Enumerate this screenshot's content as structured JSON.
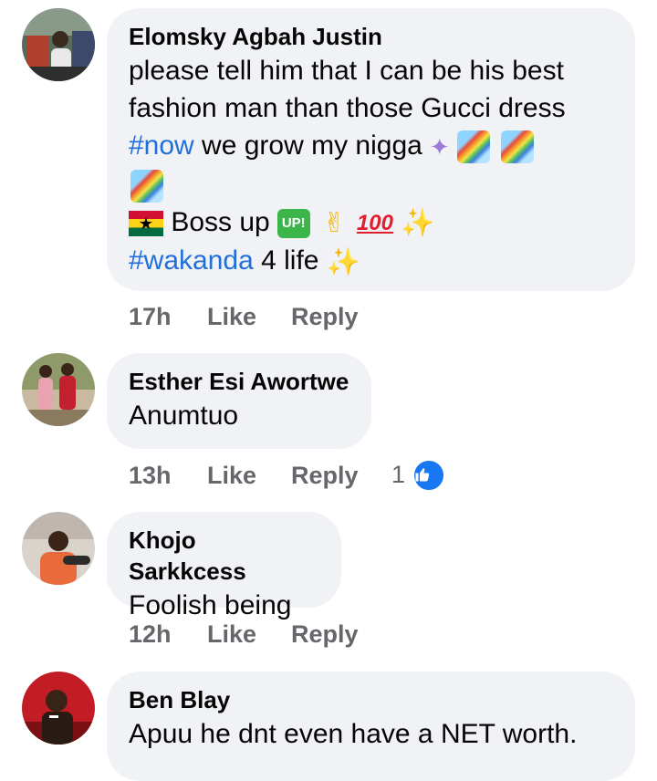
{
  "comments": [
    {
      "author": "Elomsky Agbah Justin",
      "lines": {
        "l1": "please tell him that I can be his best",
        "l2": "fashion man than those Gucci dress",
        "l3_tag": "#now",
        "l3_text": " we grow my nigga",
        "l5_text": "Boss up",
        "l5_up": "UP!",
        "l5_hundred": "100",
        "l6_tag": "#wakanda",
        "l6_text": " 4 life"
      },
      "emojis": [
        "orbit-emoji",
        "rainbow-emoji",
        "rainbow-emoji",
        "rainbow-emoji",
        "ghana-flag-emoji",
        "up-button-emoji",
        "victory-hand-emoji",
        "hundred-points-emoji",
        "sparkles-emoji",
        "sparkles-emoji"
      ],
      "time": "17h",
      "like_label": "Like",
      "reply_label": "Reply"
    },
    {
      "author": "Esther Esi Awortwe",
      "text": "Anumtuo",
      "time": "13h",
      "like_label": "Like",
      "reply_label": "Reply",
      "reaction_count": "1"
    },
    {
      "author": "Khojo Sarkkcess",
      "text": "Foolish being",
      "time": "12h",
      "like_label": "Like",
      "reply_label": "Reply"
    },
    {
      "author": "Ben Blay",
      "text": "Apuu he dnt even have a NET worth."
    }
  ],
  "colors": {
    "bubble": "#f0f2f5",
    "hashtag": "#216fdb",
    "meta": "#65676b",
    "like_badge": "#1877f2"
  }
}
